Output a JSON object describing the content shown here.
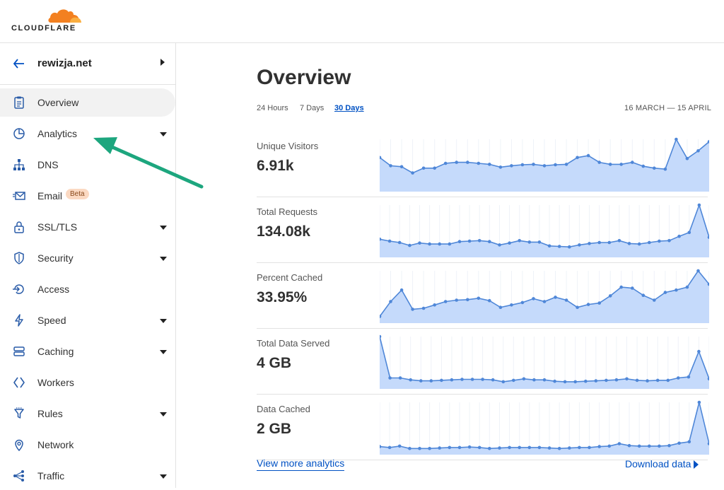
{
  "header": {
    "logo_text": "CLOUDFLARE"
  },
  "colors": {
    "brand_orange": "#f38020",
    "link_blue": "#0051c3",
    "chart_fill": "#c5dafb",
    "chart_line": "#4f87d8",
    "annotation_arrow": "#1da67e"
  },
  "sidebar": {
    "domain": "rewizja.net",
    "items": [
      {
        "label": "Overview",
        "icon": "clipboard-icon",
        "caret": false,
        "active": true
      },
      {
        "label": "Analytics",
        "icon": "pie-chart-icon",
        "caret": true
      },
      {
        "label": "DNS",
        "icon": "network-tree-icon",
        "caret": false
      },
      {
        "label": "Email",
        "icon": "envelope-icon",
        "caret": false,
        "badge": "Beta"
      },
      {
        "label": "SSL/TLS",
        "icon": "lock-icon",
        "caret": true
      },
      {
        "label": "Security",
        "icon": "shield-icon",
        "caret": true
      },
      {
        "label": "Access",
        "icon": "access-icon",
        "caret": false
      },
      {
        "label": "Speed",
        "icon": "lightning-icon",
        "caret": true
      },
      {
        "label": "Caching",
        "icon": "server-stack-icon",
        "caret": true
      },
      {
        "label": "Workers",
        "icon": "workers-icon",
        "caret": false
      },
      {
        "label": "Rules",
        "icon": "filter-icon",
        "caret": true
      },
      {
        "label": "Network",
        "icon": "location-pin-icon",
        "caret": false
      },
      {
        "label": "Traffic",
        "icon": "share-nodes-icon",
        "caret": true
      }
    ]
  },
  "main": {
    "title": "Overview",
    "ranges": [
      "24 Hours",
      "7 Days",
      "30 Days"
    ],
    "selected_range": "30 Days",
    "date_range": "16 MARCH — 15 APRIL",
    "metrics": [
      {
        "label": "Unique Visitors",
        "value": "6.91k",
        "spark": [
          0.62,
          0.45,
          0.43,
          0.3,
          0.4,
          0.4,
          0.5,
          0.52,
          0.52,
          0.5,
          0.48,
          0.42,
          0.45,
          0.47,
          0.48,
          0.45,
          0.47,
          0.48,
          0.62,
          0.66,
          0.52,
          0.48,
          0.48,
          0.52,
          0.44,
          0.4,
          0.38,
          1.0,
          0.6,
          0.76,
          0.95
        ]
      },
      {
        "label": "Total Requests",
        "value": "134.08k",
        "spark": [
          0.29,
          0.25,
          0.22,
          0.16,
          0.21,
          0.19,
          0.19,
          0.19,
          0.24,
          0.25,
          0.26,
          0.24,
          0.17,
          0.21,
          0.26,
          0.23,
          0.23,
          0.15,
          0.14,
          0.13,
          0.17,
          0.2,
          0.22,
          0.22,
          0.26,
          0.2,
          0.19,
          0.22,
          0.25,
          0.26,
          0.35,
          0.43,
          1.0,
          0.33
        ]
      },
      {
        "label": "Percent Cached",
        "value": "33.95%",
        "spark": [
          0.05,
          0.36,
          0.6,
          0.2,
          0.22,
          0.29,
          0.36,
          0.39,
          0.4,
          0.43,
          0.38,
          0.24,
          0.29,
          0.34,
          0.42,
          0.36,
          0.45,
          0.39,
          0.24,
          0.3,
          0.33,
          0.48,
          0.66,
          0.64,
          0.49,
          0.39,
          0.55,
          0.6,
          0.66,
          1.0,
          0.72
        ]
      },
      {
        "label": "Total Data Served",
        "value": "4 GB",
        "spark": [
          1.0,
          0.14,
          0.14,
          0.1,
          0.08,
          0.08,
          0.09,
          0.1,
          0.11,
          0.11,
          0.11,
          0.1,
          0.06,
          0.09,
          0.12,
          0.1,
          0.1,
          0.07,
          0.06,
          0.06,
          0.07,
          0.08,
          0.09,
          0.1,
          0.12,
          0.09,
          0.08,
          0.09,
          0.09,
          0.14,
          0.16,
          0.69,
          0.12
        ]
      },
      {
        "label": "Data Cached",
        "value": "2 GB",
        "spark": [
          0.08,
          0.06,
          0.09,
          0.04,
          0.04,
          0.04,
          0.05,
          0.06,
          0.06,
          0.07,
          0.06,
          0.04,
          0.05,
          0.06,
          0.06,
          0.06,
          0.06,
          0.05,
          0.04,
          0.05,
          0.06,
          0.06,
          0.08,
          0.09,
          0.14,
          0.1,
          0.09,
          0.09,
          0.09,
          0.1,
          0.15,
          0.18,
          1.0,
          0.14
        ]
      }
    ],
    "view_more": "View more analytics",
    "download": "Download data"
  }
}
